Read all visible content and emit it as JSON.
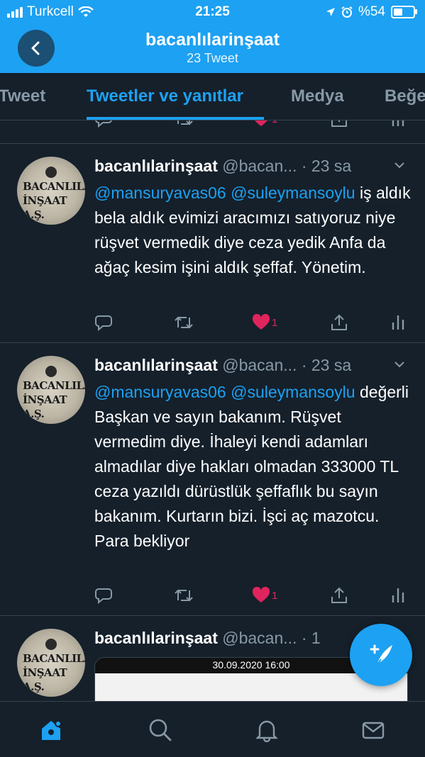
{
  "status_bar": {
    "carrier": "Turkcell",
    "time": "21:25",
    "battery_text": "%54",
    "battery_level": 0.54
  },
  "header": {
    "profile_name": "bacanlılarinşaat",
    "tweet_count": "23 Tweet",
    "back_icon": "chevron-left-icon"
  },
  "tabs": [
    {
      "label": "Tweet",
      "active": false
    },
    {
      "label": "Tweetler ve yanıtlar",
      "active": true
    },
    {
      "label": "Medya",
      "active": false
    },
    {
      "label": "Beğe",
      "active": false
    }
  ],
  "avatar": {
    "line1": "BACANLILAR",
    "line2": "İNŞAAT A.Ş."
  },
  "tweets": [
    {
      "name": "bacanlılarinşaat",
      "handle": "@bacan...",
      "time": "· 23 sa",
      "mention1": "@mansuryavas06",
      "mention2": "@suleymansoylu",
      "text": "iş aldık bela aldık evimizi aracımızı satıyoruz niye rüşvet vermedik diye ceza yedik  Anfa da ağaç kesim işini aldık  şeffaf. Yönetim.",
      "likes": "1"
    },
    {
      "name": "bacanlılarinşaat",
      "handle": "@bacan...",
      "time": "· 23 sa",
      "mention1": "@mansuryavas06",
      "mention2": "@suleymansoylu",
      "text": "değerli Başkan ve sayın bakanım. Rüşvet vermedim diye. İhaleyi kendi adamları almadılar diye  hakları olmadan 333000 TL ceza  yazıldı dürüstlük şeffaflık bu  sayın bakanım. Kurtarın bizi. İşci aç mazotcu. Para bekliyor",
      "likes": "1"
    },
    {
      "name": "bacanlılarinşaat",
      "handle": "@bacan...",
      "time": "· 1",
      "media_date": "30.09.2020 16:00"
    }
  ],
  "partial_tweet": {
    "likes": "1"
  },
  "icons": {
    "reply": "reply-icon",
    "retweet": "retweet-icon",
    "like": "heart-icon",
    "share": "share-icon",
    "analytics": "analytics-icon",
    "compose": "compose-tweet-icon",
    "home": "home-icon",
    "search": "search-icon",
    "notifications": "bell-icon",
    "messages": "mail-icon"
  },
  "colors": {
    "accent": "#1da1f2",
    "background": "#15202b",
    "like": "#e0245e",
    "muted": "#8899a6"
  }
}
